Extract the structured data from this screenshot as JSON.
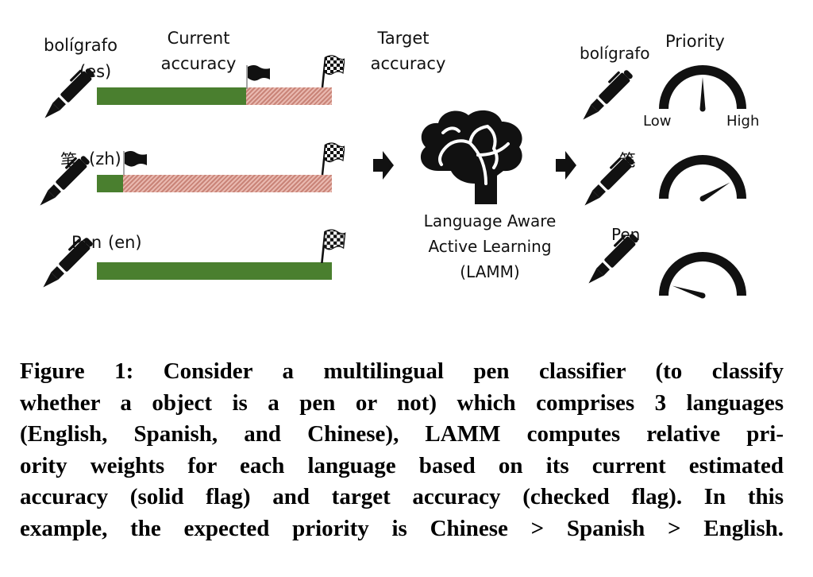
{
  "figure": {
    "header": {
      "current_label": [
        "Current",
        "accuracy"
      ],
      "target_label": [
        "Target",
        "accuracy"
      ]
    },
    "languages": [
      {
        "word": "bolígrafo",
        "code": "(es)",
        "current_accuracy": 0.635,
        "target_accuracy": 1.0,
        "priority": 0.5
      },
      {
        "word": "笔",
        "code": "(zh)",
        "current_accuracy": 0.11,
        "target_accuracy": 1.0,
        "priority": 0.83
      },
      {
        "word": "Pen",
        "code": "(en)",
        "current_accuracy": 1.0,
        "target_accuracy": 1.0,
        "priority": 0.1
      }
    ],
    "model_label": [
      "Language Aware",
      "Active Learning",
      "(LAMM)"
    ],
    "priority_title": "Priority",
    "gauge_low": "Low",
    "gauge_high": "High",
    "colors": {
      "current": "#4a7f2f",
      "remaining": "#d99a90",
      "icons": "#111111"
    },
    "icons": {
      "pen": "pen-icon",
      "current_flag": "solid-flag-icon",
      "target_flag": "checkered-flag-icon",
      "model": "brain-icon",
      "arrow": "right-arrow-icon",
      "gauge": "gauge-icon"
    }
  },
  "caption": {
    "lines": [
      "Figure 1: Consider a multilingual pen classifier (to classify",
      "whether a object is a pen or not) which comprises 3 languages",
      "(English, Spanish, and Chinese), LAMM computes relative pri-",
      "ority weights for each language based on its current estimated",
      "accuracy (solid flag) and target accuracy (checked flag). In this",
      "example, the expected priority is Chinese > Spanish > English."
    ]
  }
}
